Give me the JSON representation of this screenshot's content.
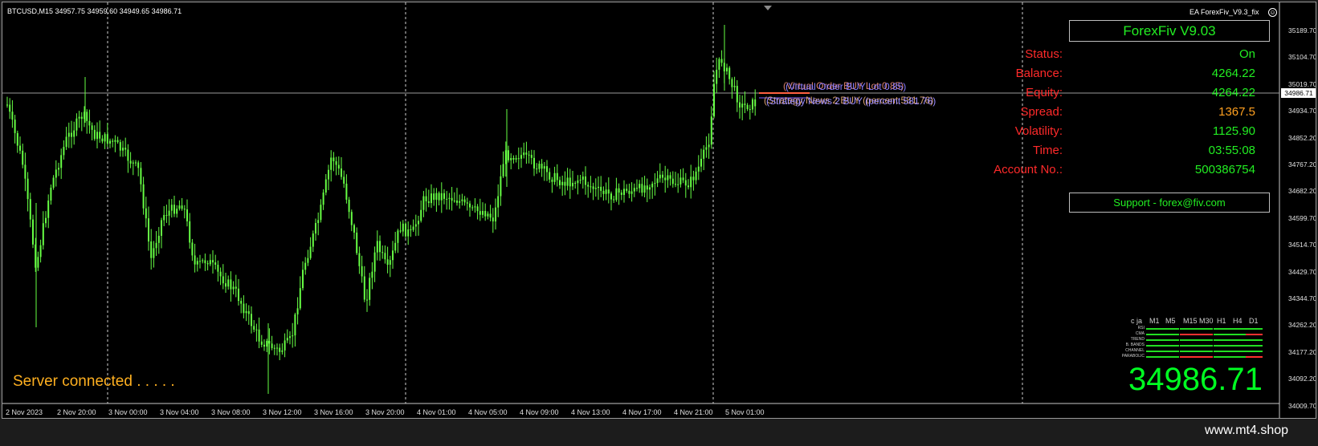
{
  "chart": {
    "symbol_info": "BTCUSD,M15  34957.75 34959.60 34949.65 34986.71",
    "ea_name": "EA ForexFiv_V9.3_fix",
    "bid_price_tag": "34986.71",
    "y_ticks": [
      "35189.70",
      "35104.70",
      "35019.70",
      "34934.70",
      "34852.20",
      "34767.20",
      "34682.20",
      "34599.70",
      "34514.70",
      "34429.70",
      "34344.70",
      "34262.20",
      "34177.20",
      "34092.20",
      "34009.70"
    ],
    "x_ticks": [
      "2 Nov 2023",
      "2 Nov 20:00",
      "3 Nov 00:00",
      "3 Nov 04:00",
      "3 Nov 08:00",
      "3 Nov 12:00",
      "3 Nov 16:00",
      "3 Nov 20:00",
      "4 Nov 01:00",
      "4 Nov 05:00",
      "4 Nov 09:00",
      "4 Nov 13:00",
      "4 Nov 17:00",
      "4 Nov 21:00",
      "5 Nov 01:00"
    ],
    "order_labels": [
      {
        "text": "(Virtual Order BUY Lot 0.85)",
        "color": "#d88070"
      },
      {
        "text": "(Strategy News 2 BUY (percent 581.76)",
        "color": "#d8a070"
      },
      {
        "text": "(Virtual Order BUY Lot 0.85)",
        "color": "#8a7cff"
      },
      {
        "text": "(Strategy News 2 BUY (percent 581.76)",
        "color": "#9b8cff"
      }
    ],
    "server_status": "Server connected . . . . .",
    "candle_color": "#66ff44"
  },
  "panel": {
    "title": "ForexFiv  V9.03",
    "rows": [
      {
        "label": "Status:",
        "value": "On",
        "value_color": "#22ee22"
      },
      {
        "label": "Balance:",
        "value": "4264.22",
        "value_color": "#22ee22"
      },
      {
        "label": "Equity:",
        "value": "4264.22",
        "value_color": "#22ee22"
      },
      {
        "label": "Spread:",
        "value": "1367.5",
        "value_color": "#ffa020"
      },
      {
        "label": "Volatility:",
        "value": "1125.90",
        "value_color": "#22ee22"
      },
      {
        "label": "Time:",
        "value": "03:55:08",
        "value_color": "#22ee22"
      },
      {
        "label": "Account No.:",
        "value": "500386754",
        "value_color": "#22ee22"
      }
    ],
    "support": "Support - forex@fiv.com",
    "big_price": "34986.71"
  },
  "indicator_grid": {
    "header": "c ja",
    "timeframes": [
      "M1",
      "M5",
      "M15",
      "M30",
      "H1",
      "H4",
      "D1"
    ],
    "rows": [
      {
        "label": "RSI",
        "cells": [
          "g",
          "g",
          "g",
          "g",
          "g",
          "g",
          "g"
        ]
      },
      {
        "label": "CMA",
        "cells": [
          "g",
          "g",
          "r",
          "r",
          "g",
          "g",
          "r"
        ]
      },
      {
        "label": "TREND",
        "cells": [
          "g",
          "g",
          "g",
          "g",
          "g",
          "g",
          "g"
        ]
      },
      {
        "label": "B. BANDS",
        "cells": [
          "g",
          "g",
          "g",
          "g",
          "g",
          "g",
          "g"
        ]
      },
      {
        "label": "CHANNEL",
        "cells": [
          "g",
          "g",
          "g",
          "g",
          "g",
          "g",
          "g"
        ]
      },
      {
        "label": "PARABOLIC",
        "cells": [
          "g",
          "g",
          "r",
          "r",
          "g",
          "g",
          "r"
        ]
      }
    ]
  },
  "footer": {
    "watermark": "www.mt4.shop"
  }
}
